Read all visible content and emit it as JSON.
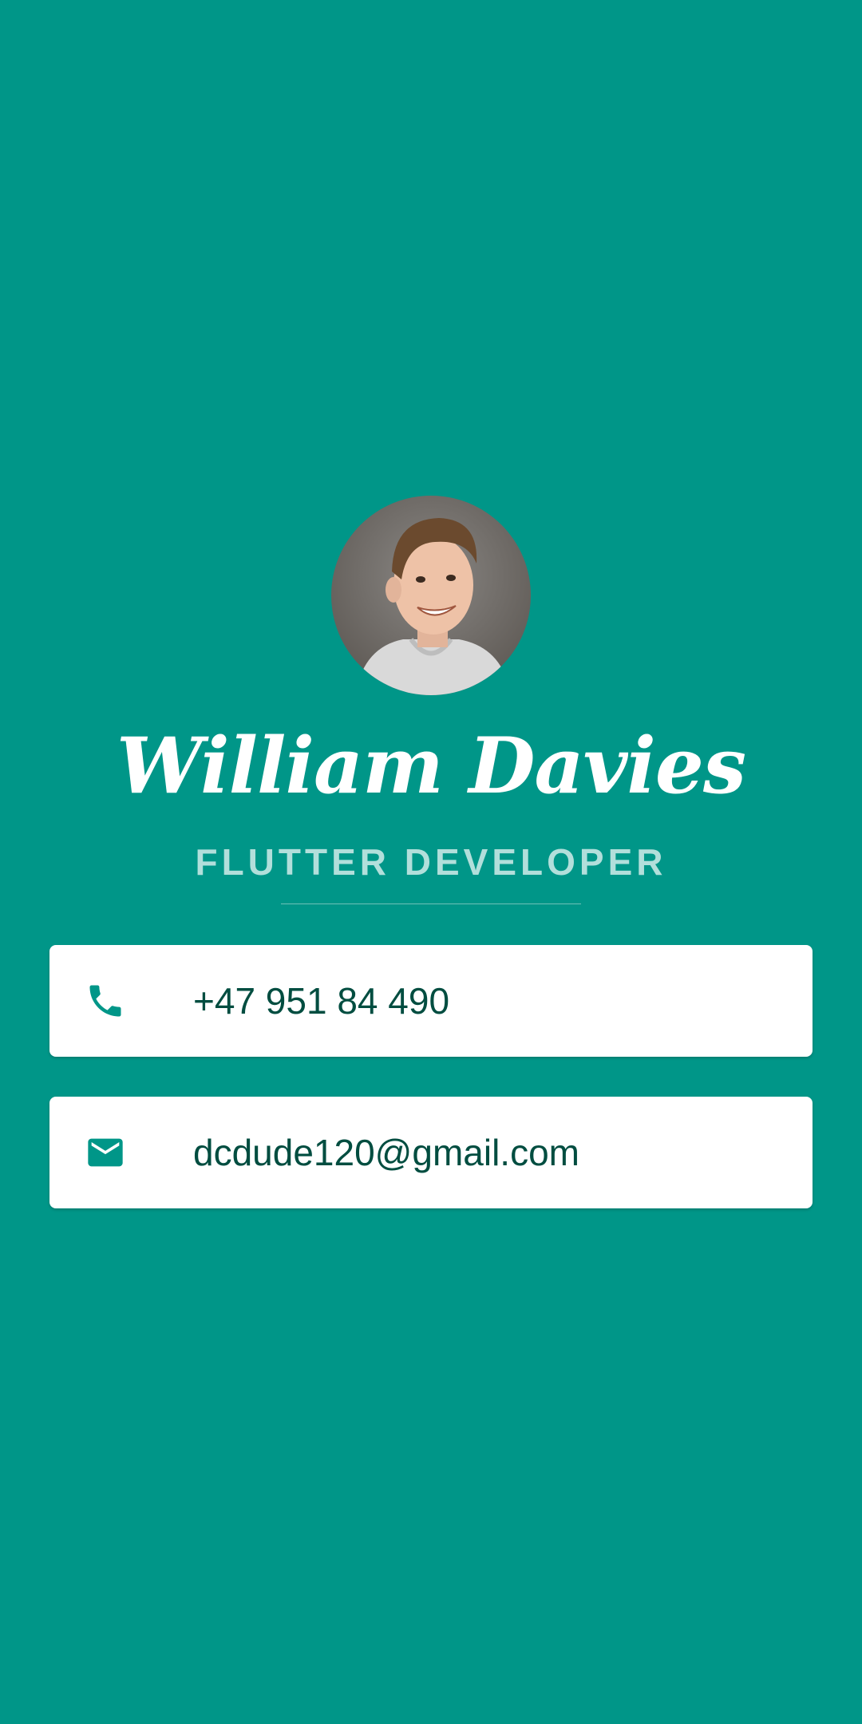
{
  "profile": {
    "name": "William Davies",
    "title": "FLUTTER DEVELOPER"
  },
  "contacts": {
    "phone": {
      "icon": "phone-icon",
      "value": "+47 951 84 490"
    },
    "email": {
      "icon": "mail-icon",
      "value": "dcdude120@gmail.com"
    }
  },
  "colors": {
    "background": "#009688",
    "card": "#ffffff",
    "text_dark": "#004d40",
    "subtitle": "#b2dfdb"
  }
}
